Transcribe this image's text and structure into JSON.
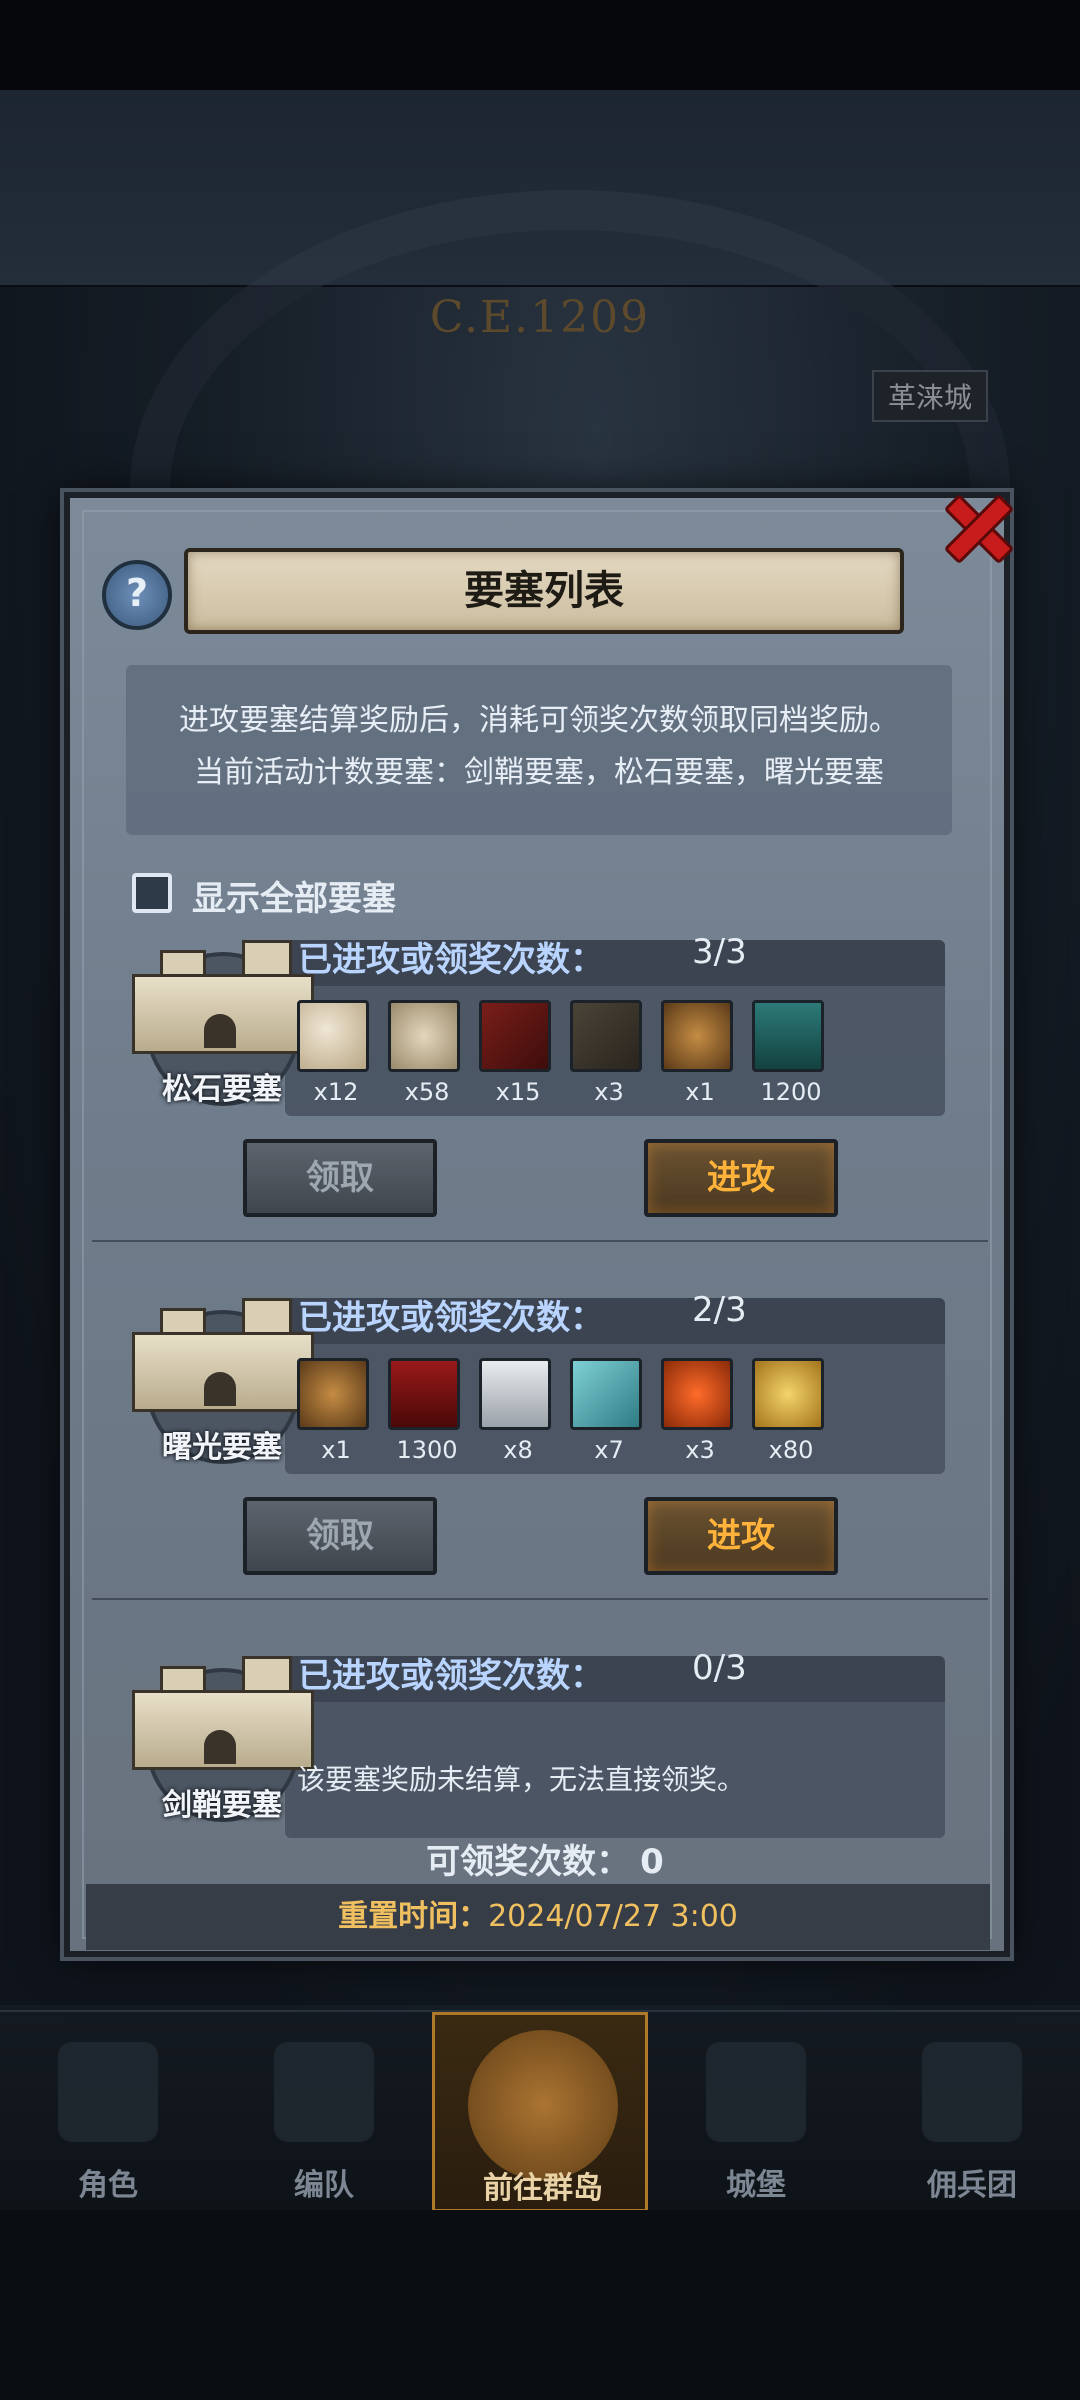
{
  "background": {
    "year": "C.E.1209",
    "city_label": "革涞城"
  },
  "modal": {
    "title": "要塞列表",
    "help_icon": "question-icon",
    "close_icon": "close-icon",
    "description": [
      "进攻要塞结算奖励后，消耗可领奖次数领取同档奖励。",
      "当前活动计数要塞：剑鞘要塞，松石要塞，曙光要塞"
    ],
    "show_all_label": "显示全部要塞",
    "show_all_checked": false,
    "fortresses": [
      {
        "name": "松石要塞",
        "count_label": "已进攻或领奖次数：",
        "count": "3/3",
        "rewards": [
          {
            "icon": "shell-icon",
            "qty": "x12"
          },
          {
            "icon": "fiber-icon",
            "qty": "x58"
          },
          {
            "icon": "wood-icon",
            "qty": "x15"
          },
          {
            "icon": "horn-icon",
            "qty": "x3"
          },
          {
            "icon": "medal-icon",
            "qty": "x1"
          },
          {
            "icon": "teal-banner-icon",
            "qty": "1200"
          }
        ],
        "claim_label": "领取",
        "attack_label": "进攻"
      },
      {
        "name": "曙光要塞",
        "count_label": "已进攻或领奖次数：",
        "count": "2/3",
        "rewards": [
          {
            "icon": "medal-icon",
            "qty": "x1"
          },
          {
            "icon": "red-banner-icon",
            "qty": "1300"
          },
          {
            "icon": "horse-icon",
            "qty": "x8"
          },
          {
            "icon": "cloth-icon",
            "qty": "x7"
          },
          {
            "icon": "caviar-icon",
            "qty": "x3"
          },
          {
            "icon": "coin-icon",
            "qty": "x80"
          }
        ],
        "claim_label": "领取",
        "attack_label": "进攻"
      },
      {
        "name": "剑鞘要塞",
        "count_label": "已进攻或领奖次数：",
        "count": "0/3",
        "note": "该要塞奖励未结算，无法直接领奖。"
      }
    ],
    "claimable_label": "可领奖次数：",
    "claimable_value": "0",
    "reset_label": "重置时间：",
    "reset_time": "2024/07/27 3:00"
  },
  "bottom_nav": [
    {
      "label": "角色",
      "icon": "knight-icon"
    },
    {
      "label": "编队",
      "icon": "formation-icon"
    },
    {
      "label": "前往群岛",
      "icon": "islands-icon",
      "active": true
    },
    {
      "label": "城堡",
      "icon": "castle-icon"
    },
    {
      "label": "佣兵团",
      "icon": "mercenary-icon"
    }
  ],
  "colors": {
    "attack_text": "#ffb33a",
    "count_label": "#b8d4ff",
    "reset_text": "#f0c060",
    "close_red": "#c81b1b"
  }
}
